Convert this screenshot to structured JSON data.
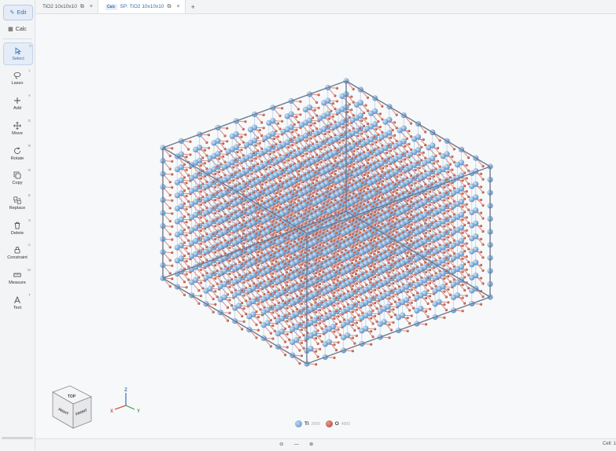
{
  "sidebar": {
    "modes": [
      {
        "label": "Edit",
        "icon": "pencil-icon",
        "active": true
      },
      {
        "label": "Calc",
        "icon": "calculator-icon",
        "active": false
      }
    ],
    "tools": [
      {
        "label": "Select",
        "hotkey": "V",
        "icon": "cursor-icon",
        "active": true
      },
      {
        "label": "Lasso",
        "hotkey": "L",
        "icon": "lasso-icon"
      },
      {
        "label": "Add",
        "hotkey": "A",
        "icon": "plus-icon"
      },
      {
        "label": "Move",
        "hotkey": "G",
        "icon": "move-icon"
      },
      {
        "label": "Rotate",
        "hotkey": "R",
        "icon": "rotate-icon"
      },
      {
        "label": "Copy",
        "hotkey": "D",
        "icon": "copy-icon"
      },
      {
        "label": "Replace",
        "hotkey": "E",
        "icon": "replace-icon"
      },
      {
        "label": "Delete",
        "hotkey": "X",
        "icon": "trash-icon"
      },
      {
        "label": "Constraint",
        "hotkey": "C",
        "icon": "lock-icon"
      },
      {
        "label": "Measure",
        "hotkey": "M",
        "icon": "ruler-icon"
      },
      {
        "label": "Text",
        "hotkey": "T",
        "icon": "text-icon"
      }
    ]
  },
  "tabs": [
    {
      "badge": "",
      "title": "TiO2 10x10x10",
      "active": false
    },
    {
      "badge": "Calc",
      "title": "SP: TiO2 10x10x10",
      "active": true
    }
  ],
  "add_tab_label": "+",
  "orientation_cube": {
    "top": "TOP",
    "front": "FRONT",
    "right": "RIGHT"
  },
  "axes": {
    "x": "X",
    "y": "Y",
    "z": "Z"
  },
  "legend": [
    {
      "symbol": "Ti",
      "count": "2000",
      "color": "#6fa3d8"
    },
    {
      "symbol": "O",
      "count": "4000",
      "color": "#c0503f"
    }
  ],
  "colors": {
    "ti": "#7fb0de",
    "o": "#c85a48",
    "cell": "#6c7a93",
    "accent": "#3a6db5"
  },
  "statusbar": {
    "zoom_out": "⊖",
    "zoom_reset": "—",
    "zoom_in": "⊕",
    "cell_info": "Cell: 1"
  }
}
